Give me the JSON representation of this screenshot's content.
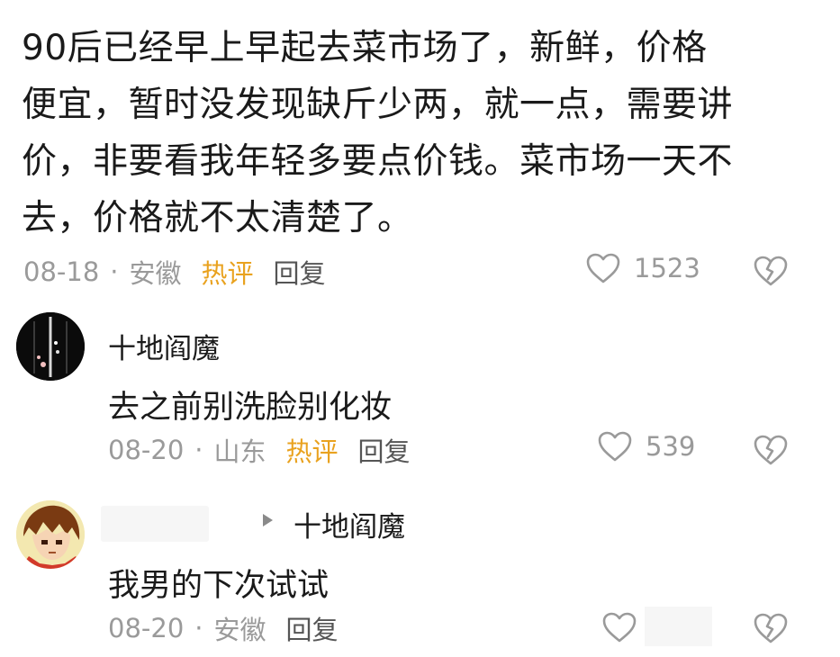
{
  "post": {
    "lines": [
      "90后已经早上早起去菜市场了，新鲜，价格",
      "便宜，暂时没发现缺斤少两，就一点，需要讲",
      "价，非要看我年轻多要点价钱。菜市场一天不",
      "去，价格就不太清楚了。"
    ],
    "date": "08-18",
    "sep": "·",
    "location": "安徽",
    "hot_label": "热评",
    "reply_label": "回复",
    "likes": "1523"
  },
  "comments": [
    {
      "username": "十地阎魔",
      "text": "去之前别洗脸别化妆",
      "date": "08-20",
      "sep": "·",
      "location": "山东",
      "hot_label": "热评",
      "reply_label": "回复",
      "likes": "539"
    },
    {
      "reply_to": "十地阎魔",
      "text": "我男的下次试试",
      "date": "08-20",
      "sep": "·",
      "location": "安徽",
      "reply_label": "回复"
    }
  ],
  "icons": {
    "like": "heart-outline-icon",
    "dislike": "broken-heart-icon",
    "reply_to": "triangle-right-icon"
  },
  "colors": {
    "hot": "#e9a21f",
    "meta": "#9a9a9a",
    "text": "#1a1a1a"
  }
}
